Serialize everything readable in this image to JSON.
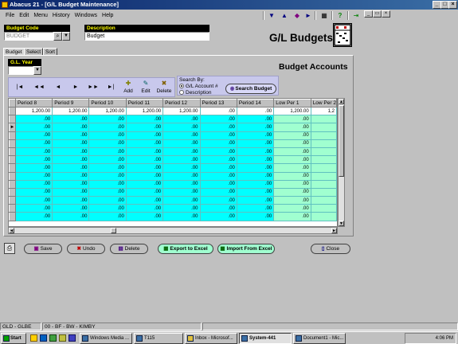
{
  "window": {
    "title": "Abacus 21 - [G/L Budget Maintenance]"
  },
  "menu": [
    "File",
    "Edit",
    "Menu",
    "History",
    "Windows",
    "Help"
  ],
  "toolbar_icons": [
    "arrow-down-icon",
    "arrow-up-icon",
    "diamond-icon",
    "arrow-right-icon",
    "calculator-icon",
    "help-icon",
    "exit-icon"
  ],
  "budget_code": {
    "label": "Budget Code",
    "value": "BUDGET"
  },
  "description": {
    "label": "Description",
    "value": "Budget"
  },
  "page_title": "G/L Budgets",
  "tabs": [
    "Budget",
    "Select",
    "Sort"
  ],
  "gl_year": {
    "label": "G.L. Year",
    "value": ""
  },
  "section_title": "Budget Accounts",
  "nav_buttons": [
    "|◄",
    "◄◄",
    "◄",
    "►",
    "►►",
    "►|"
  ],
  "actions": [
    {
      "label": "Add",
      "icon": "add-icon"
    },
    {
      "label": "Edit",
      "icon": "edit-icon"
    },
    {
      "label": "Delete",
      "icon": "delete-icon"
    }
  ],
  "search": {
    "label": "Search By:",
    "options": [
      "G/L Account #",
      "Description"
    ],
    "selected": 0,
    "button": "Search Budget"
  },
  "grid": {
    "columns": [
      "Period 8",
      "Period 9",
      "Period 10",
      "Period 11",
      "Period 12",
      "Period 13",
      "Period 14",
      "Low Per 1",
      "Low Per 2"
    ],
    "rows": [
      [
        "1,200.00",
        "1,200.00",
        "1,200.00",
        "1,200.00",
        "1,200.00",
        ".00",
        ".00",
        "1,200.00",
        "1,2"
      ],
      [
        ".00",
        ".00",
        ".00",
        ".00",
        ".00",
        ".00",
        ".00",
        ".00",
        ""
      ],
      [
        ".00",
        ".00",
        ".00",
        ".00",
        ".00",
        ".00",
        ".00",
        ".00",
        ""
      ],
      [
        ".00",
        ".00",
        ".00",
        ".00",
        ".00",
        ".00",
        ".00",
        ".00",
        ""
      ],
      [
        ".00",
        ".00",
        ".00",
        ".00",
        ".00",
        ".00",
        ".00",
        ".00",
        ""
      ],
      [
        ".00",
        ".00",
        ".00",
        ".00",
        ".00",
        ".00",
        ".00",
        ".00",
        ""
      ],
      [
        ".00",
        ".00",
        ".00",
        ".00",
        ".00",
        ".00",
        ".00",
        ".00",
        ""
      ],
      [
        ".00",
        ".00",
        ".00",
        ".00",
        ".00",
        ".00",
        ".00",
        ".00",
        ""
      ],
      [
        ".00",
        ".00",
        ".00",
        ".00",
        ".00",
        ".00",
        ".00",
        ".00",
        ""
      ],
      [
        ".00",
        ".00",
        ".00",
        ".00",
        ".00",
        ".00",
        ".00",
        ".00",
        ""
      ],
      [
        ".00",
        ".00",
        ".00",
        ".00",
        ".00",
        ".00",
        ".00",
        ".00",
        ""
      ],
      [
        ".00",
        ".00",
        ".00",
        ".00",
        ".00",
        ".00",
        ".00",
        ".00",
        ""
      ],
      [
        ".00",
        ".00",
        ".00",
        ".00",
        ".00",
        ".00",
        ".00",
        ".00",
        ""
      ],
      [
        ".00",
        ".00",
        ".00",
        ".00",
        ".00",
        ".00",
        ".00",
        ".00",
        ""
      ]
    ]
  },
  "bottom_buttons": {
    "save": "Save",
    "undo": "Undo",
    "delete": "Delete",
    "export": "Export to Excel",
    "import": "Import From Excel",
    "close": "Close"
  },
  "status": {
    "left": "GLD - GLBE",
    "right": "00 - BF - BW - KIMBY"
  },
  "taskbar": {
    "start": "Start",
    "tasks": [
      "Windows Media ...",
      "T115",
      "Inbox - Microsof...",
      "System-441",
      "Document1 - Mic..."
    ],
    "active_index": 3,
    "clock": "4:06 PM"
  },
  "colors": {
    "grid_fill": "#00ffff",
    "low_fill": "#a0ffd0",
    "search_panel": "#c8c8ec",
    "label_bg": "#000000",
    "label_fg": "#ffff00"
  }
}
